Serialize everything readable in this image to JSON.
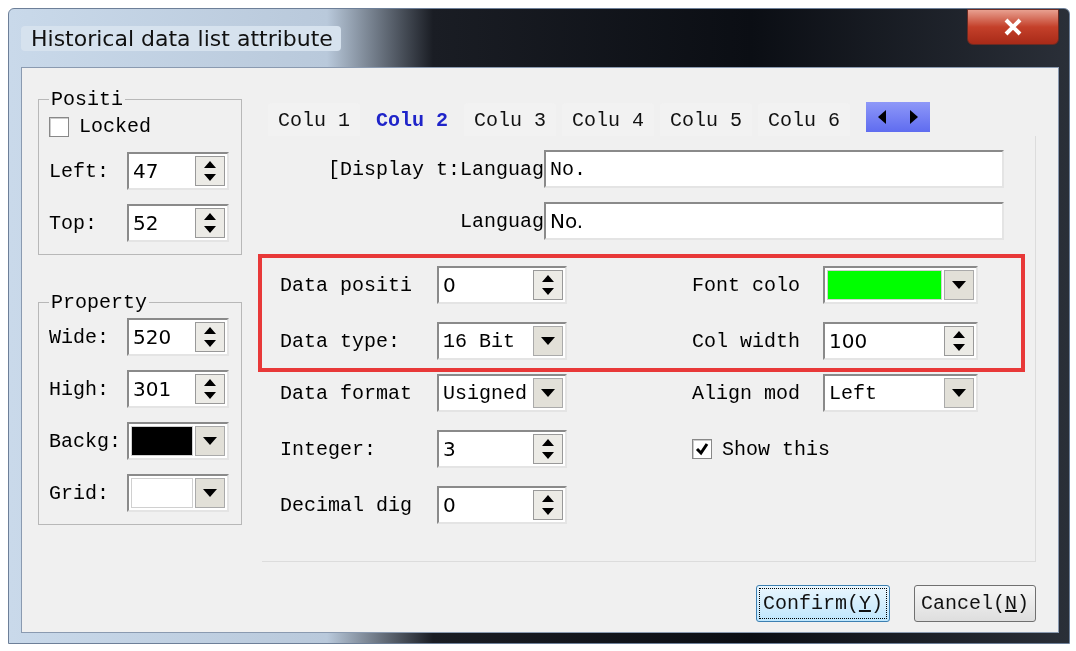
{
  "window": {
    "title": "Historical data list attribute"
  },
  "position_group": {
    "title": "Positi",
    "locked": {
      "label": "Locked",
      "checked": false
    },
    "fields": [
      {
        "label": "Left:",
        "kind": "spin",
        "value": "47"
      },
      {
        "label": "Top:",
        "kind": "spin",
        "value": "52"
      }
    ]
  },
  "property_group": {
    "title": "Property",
    "fields": [
      {
        "label": "Wide:",
        "kind": "spin",
        "value": "520"
      },
      {
        "label": "High:",
        "kind": "spin",
        "value": "301"
      },
      {
        "label": "Backg:",
        "kind": "color",
        "color": "#000000"
      },
      {
        "label": "Grid:",
        "kind": "color",
        "color": "#ffffff"
      }
    ]
  },
  "tabs": [
    {
      "label": "Colu 1",
      "selected": false
    },
    {
      "label": "Colu 2",
      "selected": true
    },
    {
      "label": "Colu 3",
      "selected": false
    },
    {
      "label": "Colu 4",
      "selected": false
    },
    {
      "label": "Colu 5",
      "selected": false
    },
    {
      "label": "Colu 6",
      "selected": false
    }
  ],
  "display_text": {
    "label": "[Display t:",
    "languages": [
      {
        "label": "Languag",
        "value": "No."
      },
      {
        "label": "Languag",
        "value": "No."
      }
    ]
  },
  "rows": [
    {
      "highlighted": true,
      "left": {
        "label": "Data positi",
        "kind": "spin",
        "value": "0"
      },
      "right": {
        "label": "Font colo",
        "kind": "color",
        "color": "#00ff00"
      }
    },
    {
      "highlighted": true,
      "left": {
        "label": "Data type:",
        "kind": "combo",
        "value": "16 Bit"
      },
      "right": {
        "label": "Col width",
        "kind": "spin",
        "value": "100"
      }
    },
    {
      "highlighted": false,
      "left": {
        "label": "Data format",
        "kind": "combo",
        "value": "Usigned"
      },
      "right": {
        "label": "Align mod",
        "kind": "combo",
        "value": "Left"
      }
    },
    {
      "highlighted": false,
      "left": {
        "label": "Integer:",
        "kind": "spin",
        "value": "3"
      },
      "right": {
        "label": "Show this",
        "kind": "check",
        "checked": true
      }
    },
    {
      "highlighted": false,
      "left": {
        "label": "Decimal dig",
        "kind": "spin",
        "value": "0"
      }
    }
  ],
  "buttons": [
    {
      "label": "Confirm(",
      "hotkey": "Y",
      "suffix": ")",
      "focused": true
    },
    {
      "label": "Cancel(",
      "hotkey": "N",
      "suffix": ")",
      "focused": false
    }
  ]
}
